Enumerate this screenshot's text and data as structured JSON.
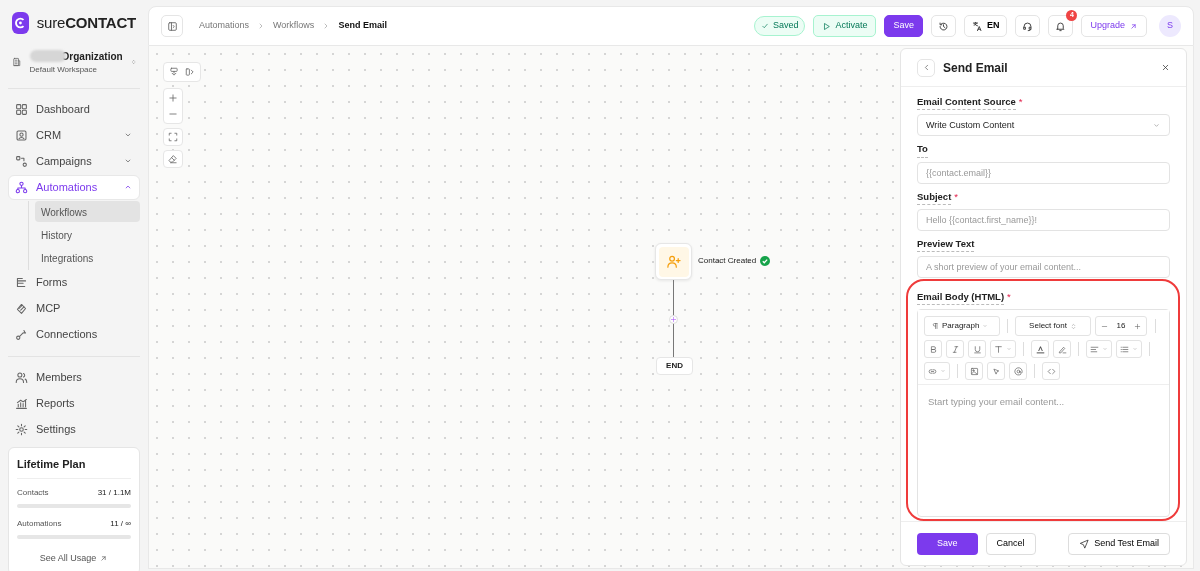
{
  "app": {
    "logo": "sure**CONTACT**"
  },
  "workspace": {
    "name": "Organization",
    "subtitle": "Default Workspace"
  },
  "nav_sections": [
    [
      {
        "label": "Dashboard",
        "selected": false
      },
      {
        "label": "CRM",
        "selected": false,
        "expanded": false
      },
      {
        "label": "Campaigns",
        "selected": false,
        "expanded": false
      },
      {
        "label": "Automations",
        "selected": true,
        "expanded": true,
        "children": [
          {
            "label": "Workflows",
            "selected": true
          },
          {
            "label": "History",
            "selected": false
          },
          {
            "label": "Integrations",
            "selected": false
          }
        ]
      },
      {
        "label": "Forms",
        "selected": false
      },
      {
        "label": "MCP",
        "selected": false
      },
      {
        "label": "Connections",
        "selected": false
      }
    ],
    [
      {
        "label": "Members",
        "selected": false
      },
      {
        "label": "Reports",
        "selected": false
      },
      {
        "label": "Settings",
        "selected": false
      }
    ]
  ],
  "plan": {
    "title": "Lifetime Plan",
    "usage": [
      {
        "label": "Contacts",
        "value": "31 / 1.1M",
        "level": 0
      },
      {
        "label": "Automations",
        "value": "11 / ∞",
        "level": 0
      }
    ],
    "link": "See All Usage"
  },
  "header": {
    "breadcrumb": [
      "Automations",
      "Workflows",
      "Send Email"
    ],
    "status": "Saved",
    "activate": "Activate",
    "save": "Save",
    "language": "EN",
    "notifications": "4",
    "upgrade": "Upgrade",
    "avatar": "S"
  },
  "canvas": {
    "trigger": {
      "label": "Contact Created",
      "complete": true
    },
    "end": "END"
  },
  "panel": {
    "title": "Send Email",
    "fields": [
      {
        "kind": "select",
        "label": "Email Content Source",
        "required_mark": "*",
        "value": "Write Custom Content"
      },
      {
        "kind": "input",
        "label": "To",
        "placeholder": "{{contact.email}}"
      },
      {
        "kind": "input",
        "label": "Subject",
        "required_mark": "*",
        "placeholder": "Hello {{contact.first_name}}!"
      },
      {
        "kind": "input",
        "label": "Preview Text",
        "placeholder": "A short preview of your email content..."
      },
      {
        "kind": "editor",
        "label": "Email Body (HTML)",
        "required_mark": "*",
        "block_type": "Paragraph",
        "font": "Select font",
        "font_size": "16",
        "placeholder": "Start typing your email content...",
        "highlighted": true
      }
    ],
    "save": "Save",
    "cancel": "Cancel",
    "send_test": "Send Test Email"
  }
}
